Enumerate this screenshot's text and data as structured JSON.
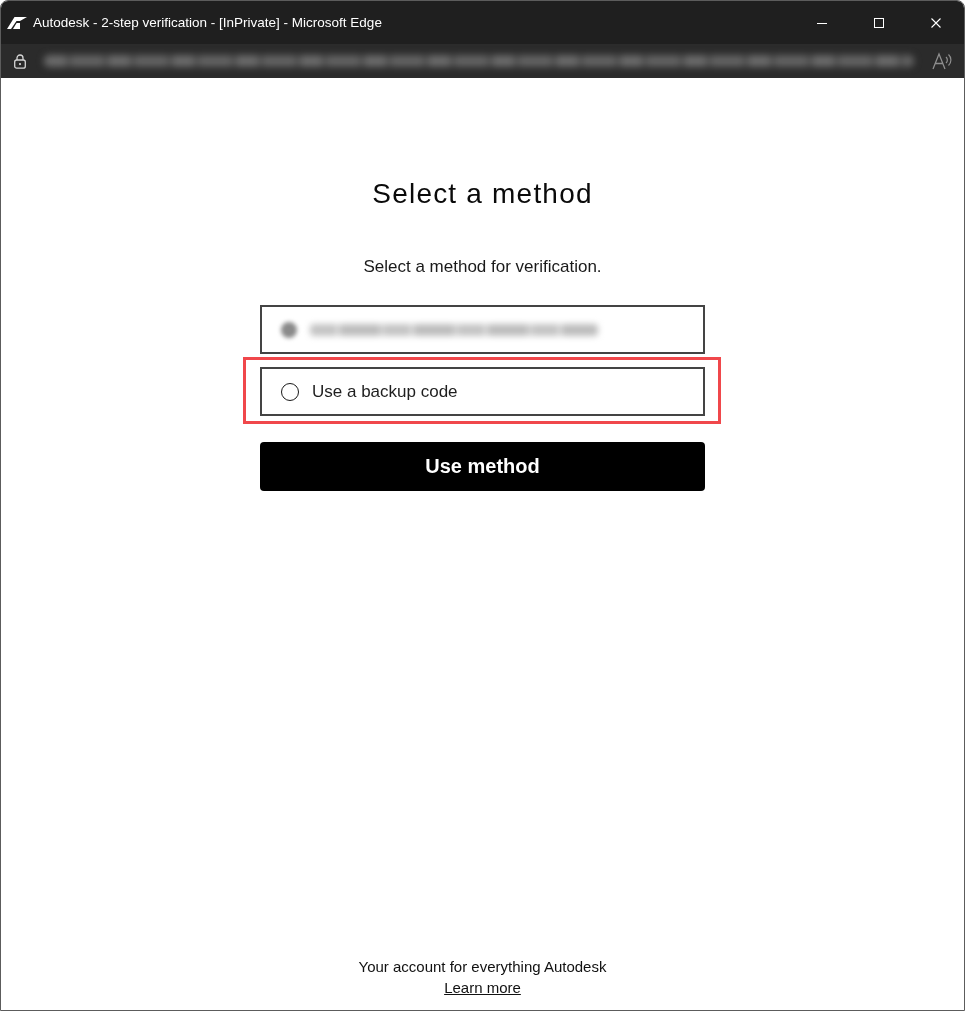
{
  "window": {
    "title": "Autodesk - 2-step verification - [InPrivate] - Microsoft Edge"
  },
  "address_bar": {
    "kind": "blurred"
  },
  "page": {
    "heading": "Select a method",
    "subtitle": "Select a method for verification."
  },
  "options": [
    {
      "kind": "blurred",
      "selected": true,
      "highlighted": false
    },
    {
      "kind": "text",
      "label": "Use a backup code",
      "selected": false,
      "highlighted": true
    }
  ],
  "primary_button": "Use method",
  "footer": {
    "tagline": "Your account for everything Autodesk",
    "link": "Learn more"
  }
}
